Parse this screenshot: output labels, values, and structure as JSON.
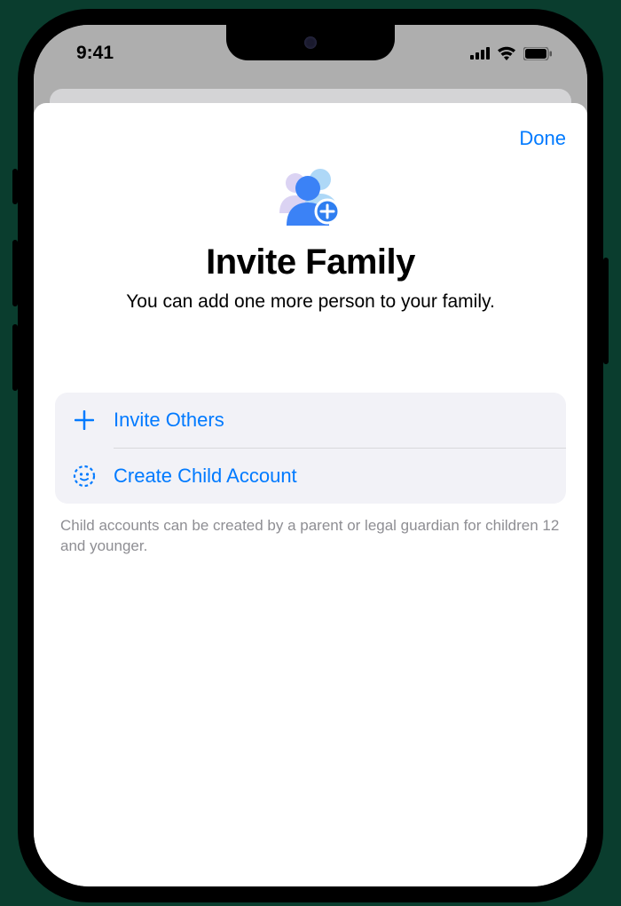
{
  "status_bar": {
    "time": "9:41"
  },
  "sheet": {
    "done_label": "Done",
    "title": "Invite Family",
    "subtitle": "You can add one more person to your family.",
    "options": {
      "invite_others": "Invite Others",
      "create_child": "Create Child Account"
    },
    "footnote": "Child accounts can be created by a parent or legal guardian for children 12 and younger."
  }
}
